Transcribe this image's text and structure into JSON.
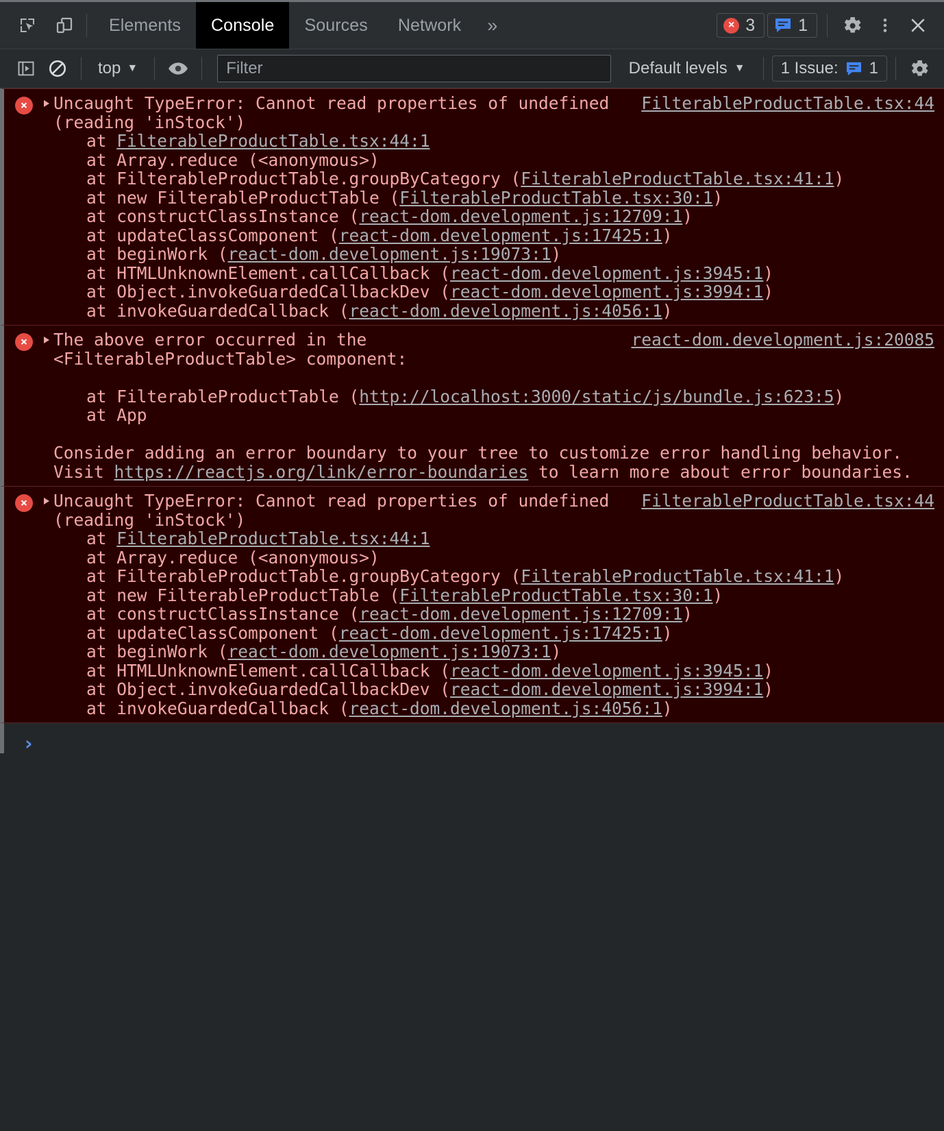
{
  "window": {
    "app": "Chrome DevTools",
    "panel": "Console"
  },
  "tabbar": {
    "inspect_icon": "inspect-cursor-icon",
    "device_icon": "device-toolbar-icon",
    "tabs": [
      {
        "label": "Elements",
        "selected": false
      },
      {
        "label": "Console",
        "selected": true
      },
      {
        "label": "Sources",
        "selected": false
      },
      {
        "label": "Network",
        "selected": false
      }
    ],
    "more_tabs_label": "»",
    "error_count": "3",
    "error_glyph": "×",
    "message_count": "1",
    "settings_icon": "gear-icon",
    "more_options_icon": "kebab-menu-icon",
    "close_icon": "close-icon"
  },
  "consolebar": {
    "sidebar_toggle_icon": "console-sidebar-icon",
    "clear_icon": "clear-console-icon",
    "context": "top",
    "context_caret": "▼",
    "eye_icon": "live-expression-eye-icon",
    "filter_placeholder": "Filter",
    "filter_value": "",
    "levels_label": "Default levels",
    "levels_caret": "▼",
    "issues_label": "1 Issue:",
    "issues_count": "1",
    "settings_icon": "console-settings-gear-icon"
  },
  "messages": [
    {
      "level": "error",
      "icon_glyph": "×",
      "header": "Uncaught TypeError: Cannot read properties of undefined",
      "header_cont": "(reading 'inStock')",
      "source_link": "FilterableProductTable.tsx:44",
      "stack": [
        {
          "prefix": "at ",
          "fn": "",
          "link": "FilterableProductTable.tsx:44:1",
          "suffix": ""
        },
        {
          "prefix": "at ",
          "fn": "Array.reduce (<anonymous>)",
          "link": "",
          "suffix": ""
        },
        {
          "prefix": "at ",
          "fn": "FilterableProductTable.groupByCategory (",
          "link": "FilterableProductTable.tsx:41:1",
          "suffix": ")"
        },
        {
          "prefix": "at ",
          "fn": "new FilterableProductTable (",
          "link": "FilterableProductTable.tsx:30:1",
          "suffix": ")"
        },
        {
          "prefix": "at ",
          "fn": "constructClassInstance (",
          "link": "react-dom.development.js:12709:1",
          "suffix": ")"
        },
        {
          "prefix": "at ",
          "fn": "updateClassComponent (",
          "link": "react-dom.development.js:17425:1",
          "suffix": ")"
        },
        {
          "prefix": "at ",
          "fn": "beginWork (",
          "link": "react-dom.development.js:19073:1",
          "suffix": ")"
        },
        {
          "prefix": "at ",
          "fn": "HTMLUnknownElement.callCallback (",
          "link": "react-dom.development.js:3945:1",
          "suffix": ")"
        },
        {
          "prefix": "at ",
          "fn": "Object.invokeGuardedCallbackDev (",
          "link": "react-dom.development.js:3994:1",
          "suffix": ")"
        },
        {
          "prefix": "at ",
          "fn": "invokeGuardedCallback (",
          "link": "react-dom.development.js:4056:1",
          "suffix": ")"
        }
      ]
    },
    {
      "level": "error",
      "icon_glyph": "×",
      "header": "The above error occurred in the",
      "header_cont": "<FilterableProductTable> component:",
      "source_link": "react-dom.development.js:20085",
      "stack": [
        {
          "prefix": "at ",
          "fn": "FilterableProductTable (",
          "link": "http://localhost:3000/static/js/bundle.js:623:5",
          "suffix": ")"
        },
        {
          "prefix": "at ",
          "fn": "App",
          "link": "",
          "suffix": ""
        }
      ],
      "footer_line_1": "Consider adding an error boundary to your tree to customize error handling behavior.",
      "footer_line_2_pre": "Visit ",
      "footer_line_2_link": "https://reactjs.org/link/error-boundaries",
      "footer_line_2_post": " to learn more about error boundaries."
    },
    {
      "level": "error",
      "icon_glyph": "×",
      "header": "Uncaught TypeError: Cannot read properties of undefined",
      "header_cont": "(reading 'inStock')",
      "source_link": "FilterableProductTable.tsx:44",
      "stack": [
        {
          "prefix": "at ",
          "fn": "",
          "link": "FilterableProductTable.tsx:44:1",
          "suffix": ""
        },
        {
          "prefix": "at ",
          "fn": "Array.reduce (<anonymous>)",
          "link": "",
          "suffix": ""
        },
        {
          "prefix": "at ",
          "fn": "FilterableProductTable.groupByCategory (",
          "link": "FilterableProductTable.tsx:41:1",
          "suffix": ")"
        },
        {
          "prefix": "at ",
          "fn": "new FilterableProductTable (",
          "link": "FilterableProductTable.tsx:30:1",
          "suffix": ")"
        },
        {
          "prefix": "at ",
          "fn": "constructClassInstance (",
          "link": "react-dom.development.js:12709:1",
          "suffix": ")"
        },
        {
          "prefix": "at ",
          "fn": "updateClassComponent (",
          "link": "react-dom.development.js:17425:1",
          "suffix": ")"
        },
        {
          "prefix": "at ",
          "fn": "beginWork (",
          "link": "react-dom.development.js:19073:1",
          "suffix": ")"
        },
        {
          "prefix": "at ",
          "fn": "HTMLUnknownElement.callCallback (",
          "link": "react-dom.development.js:3945:1",
          "suffix": ")"
        },
        {
          "prefix": "at ",
          "fn": "Object.invokeGuardedCallbackDev (",
          "link": "react-dom.development.js:3994:1",
          "suffix": ")"
        },
        {
          "prefix": "at ",
          "fn": "invokeGuardedCallback (",
          "link": "react-dom.development.js:4056:1",
          "suffix": ")"
        }
      ]
    }
  ],
  "prompt": {
    "chevron": "›",
    "value": ""
  },
  "colors": {
    "error_bg": "#290000",
    "error_text": "#f2a6a6",
    "link": "#a9adb2",
    "toolbar_bg": "#282b2e",
    "tabbar_bg": "#2b2e31",
    "console_bg": "#242729",
    "error_badge": "#e64c44",
    "info_badge": "#4285f4",
    "prompt_chevron": "#5a8bea",
    "selected_tab_bg": "#000000"
  }
}
